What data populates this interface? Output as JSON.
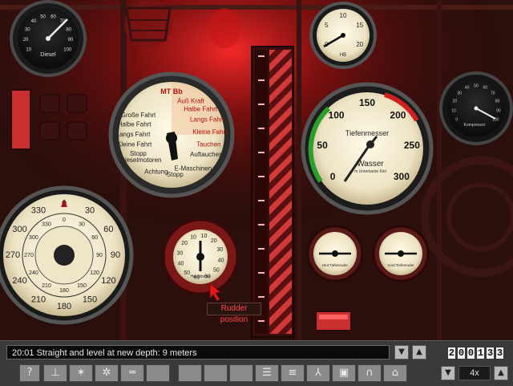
{
  "gauges": {
    "diesel": {
      "label": "Diesel",
      "ticks": [
        "10",
        "20",
        "30",
        "40",
        "50",
        "60",
        "70",
        "80",
        "90",
        "100"
      ]
    },
    "hb": {
      "label": "HB",
      "ticks": [
        "0",
        "5",
        "10",
        "15",
        "20"
      ]
    },
    "kompressor": {
      "label": "Kompressor",
      "ticks": [
        "0",
        "10",
        "20",
        "30",
        "40",
        "50",
        "60",
        "70",
        "80",
        "90",
        "100"
      ]
    },
    "telegraph": {
      "title": "MT Bb",
      "left_labels": [
        "Große Fahrt",
        "Halbe Fahrt",
        "Langs Fahrt",
        "Kleine Fahrt",
        "Stopp"
      ],
      "right_labels": [
        "Äuß Kraft",
        "Halbe Fahrt",
        "Langs Fahrt",
        "Kleine Fahrt",
        "Tauchen"
      ],
      "bottom_labels": [
        "Auftauchen",
        "E-Maschinen",
        "Stopp",
        "Achtung",
        "Dieselmotoren"
      ]
    },
    "depth": {
      "title": "Tiefenmesser",
      "sublabel": "Wasser",
      "note": "m Unterkante Kiel",
      "ticks": [
        "0",
        "50",
        "100",
        "150",
        "200",
        "250",
        "300"
      ]
    },
    "compass": {
      "ticks": [
        "0",
        "30",
        "60",
        "90",
        "120",
        "150",
        "180",
        "210",
        "240",
        "270",
        "300",
        "330"
      ]
    },
    "rudder": {
      "label": "Hauptruder",
      "ticks": [
        "10",
        "20",
        "30",
        "40",
        "50",
        "60",
        "60",
        "50",
        "40",
        "30",
        "20",
        "10"
      ]
    },
    "hint_planes": {
      "label": "Hint Tiefenruder"
    },
    "vord_planes": {
      "label": "Vord Tiefenruder"
    }
  },
  "tooltip": "Rudder position",
  "message": {
    "time": "20:01",
    "text": "Straight and level at new depth: 9 meters"
  },
  "counter": [
    "2",
    "0",
    "0",
    "1",
    "3",
    "3"
  ],
  "time_compression": "4x",
  "toolbar": {
    "help": "?",
    "icons": [
      "periscope-icon",
      "star-icon",
      "gear-icon",
      "torpedo-icon",
      "blank",
      "blank",
      "blank",
      "blank",
      "chart-icon",
      "list-icon",
      "crew-icon",
      "radio-icon",
      "headphones-icon",
      "uniform-icon"
    ]
  },
  "colors": {
    "red_glow": "#c81414",
    "panel": "#3a3a3a",
    "gauge_face": "#f4efd8"
  }
}
